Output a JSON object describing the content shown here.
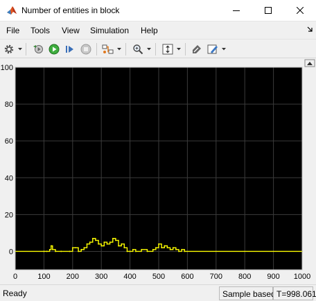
{
  "window": {
    "title": "Number of entities in block"
  },
  "menu": {
    "items": [
      "File",
      "Tools",
      "View",
      "Simulation",
      "Help"
    ]
  },
  "toolbar": {
    "icons": [
      "gear-icon",
      "restore-icon",
      "run-icon",
      "step-forward-icon",
      "stop-icon",
      "signal-selector-icon",
      "zoom-icon",
      "scale-axes-icon",
      "style-icon",
      "highlight-icon"
    ]
  },
  "colors": {
    "plot_background": "#000000",
    "grid": "#3b3b3b",
    "axis": "#c0c0c0",
    "trace": "#ffff00",
    "tick_label": "#000000"
  },
  "chart_data": {
    "type": "line",
    "title": "",
    "xlabel": "",
    "ylabel": "",
    "xlim": [
      0,
      1000
    ],
    "ylim": [
      -10,
      100
    ],
    "x_ticks": [
      0,
      100,
      200,
      300,
      400,
      500,
      600,
      700,
      800,
      900,
      1000
    ],
    "y_ticks": [
      0,
      20,
      40,
      60,
      80,
      100
    ],
    "grid": true,
    "series": [
      {
        "x": [
          0,
          100,
          110,
          120,
          125,
          130,
          140,
          160,
          190,
          200,
          210,
          220,
          230,
          240,
          250,
          260,
          270,
          280,
          290,
          300,
          310,
          320,
          330,
          340,
          350,
          360,
          370,
          380,
          390,
          400,
          410,
          420,
          440,
          460,
          480,
          490,
          500,
          510,
          520,
          530,
          540,
          550,
          560,
          570,
          580,
          590,
          1000
        ],
        "values": [
          0,
          0,
          0,
          1,
          3,
          1,
          0,
          0,
          0,
          2,
          2,
          0,
          1,
          2,
          4,
          5,
          7,
          6,
          4,
          3,
          5,
          4,
          5,
          7,
          6,
          3,
          4,
          2,
          0,
          0,
          1,
          0,
          1,
          0,
          1,
          2,
          4,
          2,
          3,
          2,
          1,
          2,
          1,
          0,
          1,
          0,
          0
        ]
      }
    ]
  },
  "status": {
    "left": "Ready",
    "mode": "Sample based",
    "time": "T=998.061"
  }
}
